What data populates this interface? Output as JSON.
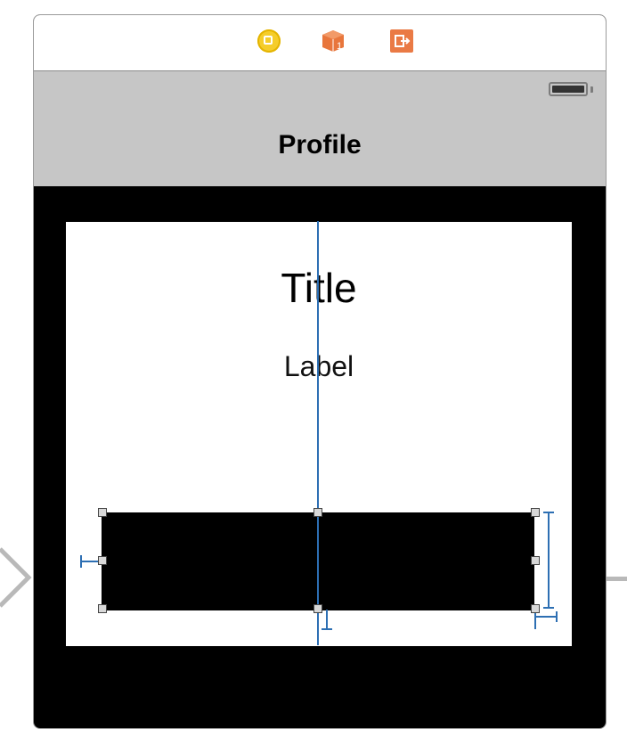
{
  "scene": {
    "dock_icons": [
      "view-controller-icon",
      "first-responder-icon",
      "exit-icon"
    ],
    "status_bar": {
      "battery_icon": "battery-icon"
    },
    "navigation_bar": {
      "title": "Profile"
    },
    "content": {
      "title_label": "Title",
      "subtitle_label": "Label",
      "selected_view": "black-view"
    }
  },
  "colors": {
    "navbar_bg": "#c6c6c6",
    "guide_blue": "#2d6fb3",
    "vc_yellow": "#f5cd2a",
    "exit_orange": "#ea7a45",
    "cube_orange": "#e8763c"
  }
}
